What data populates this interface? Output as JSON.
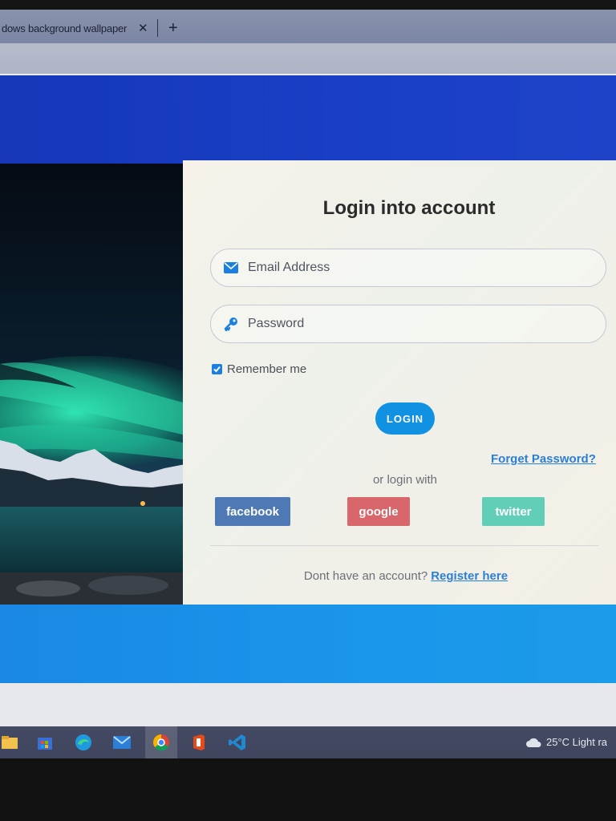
{
  "browser": {
    "tab_title": "dows background wallpaper -",
    "tab_close": "✕",
    "new_tab": "+"
  },
  "login": {
    "title": "Login into account",
    "email_placeholder": "Email Address",
    "password_placeholder": "Password",
    "remember_label": "Remember me",
    "remember_checked": true,
    "login_button": "LOGIN",
    "forget_password": "Forget Password?",
    "or_text": "or login with",
    "social": {
      "facebook": "facebook",
      "google": "google",
      "twitter": "twitter"
    },
    "register_prompt": "Dont have an account?",
    "register_link": "Register here"
  },
  "colors": {
    "top_band": "#1a3fc7",
    "bottom_band": "#1a94e8",
    "accent": "#1091e2",
    "facebook": "#4f79b5",
    "google": "#d9666a",
    "twitter": "#61cfb8"
  },
  "taskbar": {
    "icons": [
      "file-explorer-icon",
      "microsoft-store-icon",
      "edge-icon",
      "mail-icon",
      "chrome-icon",
      "office-icon",
      "vscode-icon"
    ],
    "weather_text": "25°C  Light ra"
  }
}
